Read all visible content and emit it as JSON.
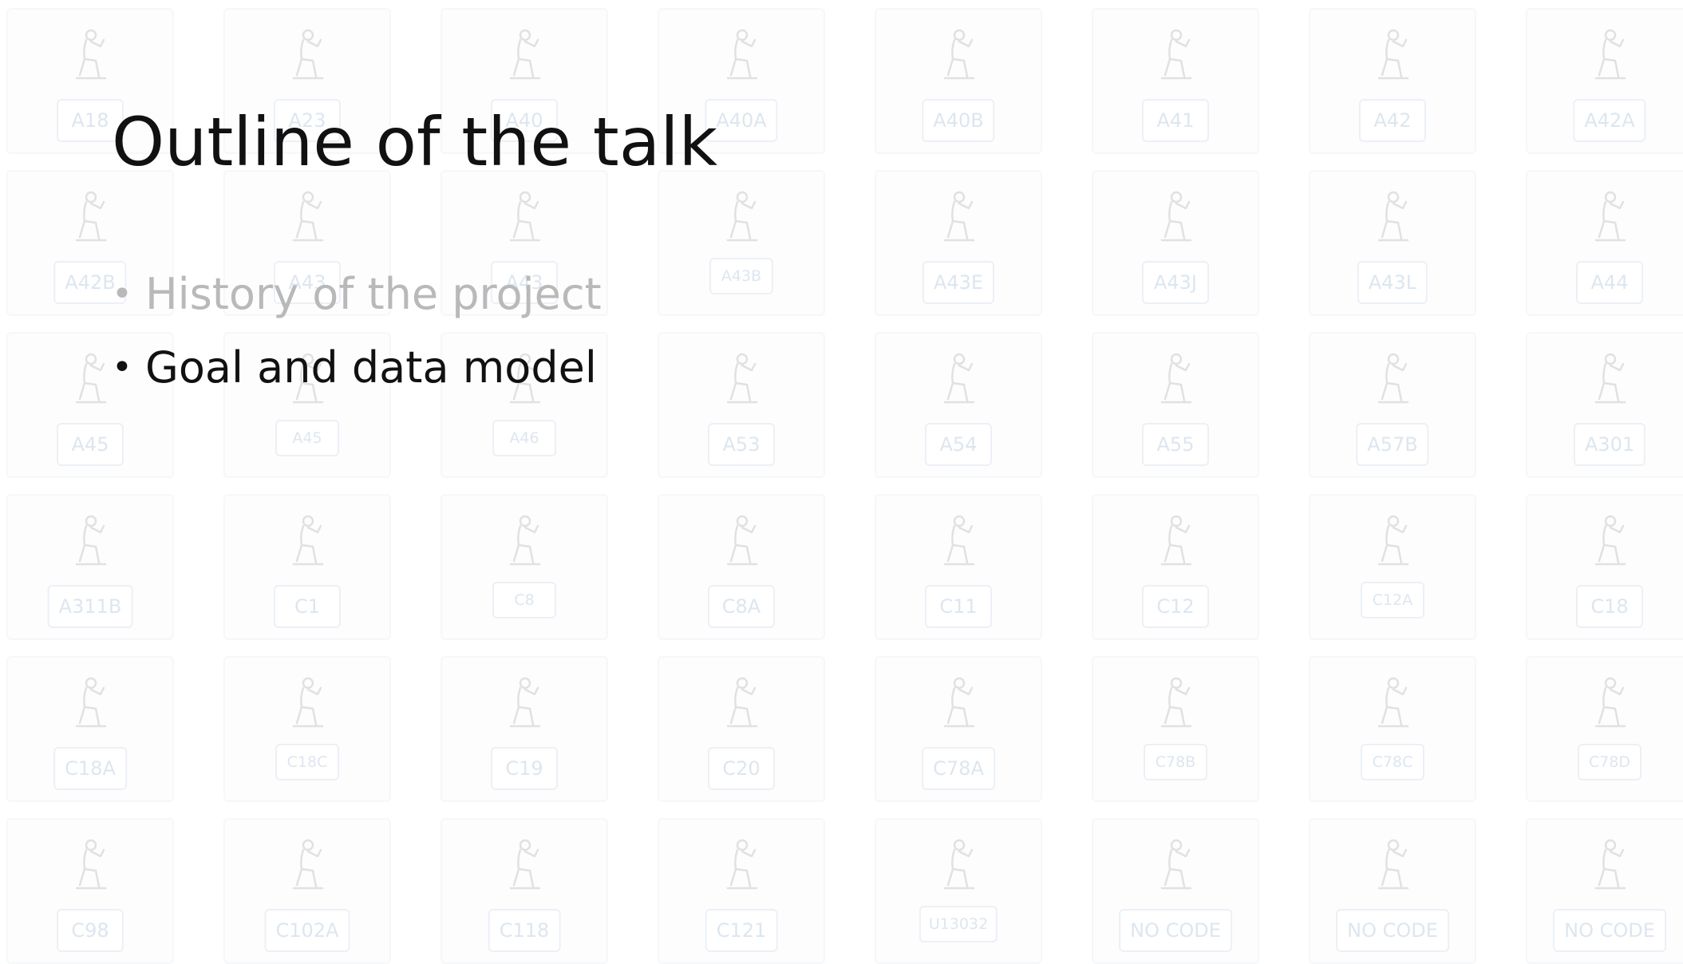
{
  "slide": {
    "title": "Outline of the talk",
    "bullets": [
      {
        "text": "History of the project",
        "state": "faded"
      },
      {
        "text": "Goal and data model",
        "state": "active"
      }
    ],
    "bullet_glyph": "•"
  },
  "sign_grid": {
    "codes": [
      "A18",
      "A23",
      "A40",
      "A40A",
      "A40B",
      "A41",
      "A42",
      "A42A",
      "A42B",
      "A43",
      "A43",
      "A43B",
      "A43E",
      "A43J",
      "A43L",
      "A44",
      "A45",
      "A45",
      "A46",
      "A53",
      "A54",
      "A55",
      "A57B",
      "A301",
      "A311B",
      "C1",
      "C8",
      "C8A",
      "C11",
      "C12",
      "C12A",
      "C18",
      "C18A",
      "C18C",
      "C19",
      "C20",
      "C78A",
      "C78B",
      "C78C",
      "C78D",
      "C98",
      "C102A",
      "C118",
      "C121",
      "U13032",
      "NO CODE",
      "NO CODE",
      "NO CODE"
    ],
    "glyph_icon": "hieroglyph-sign-icon"
  }
}
